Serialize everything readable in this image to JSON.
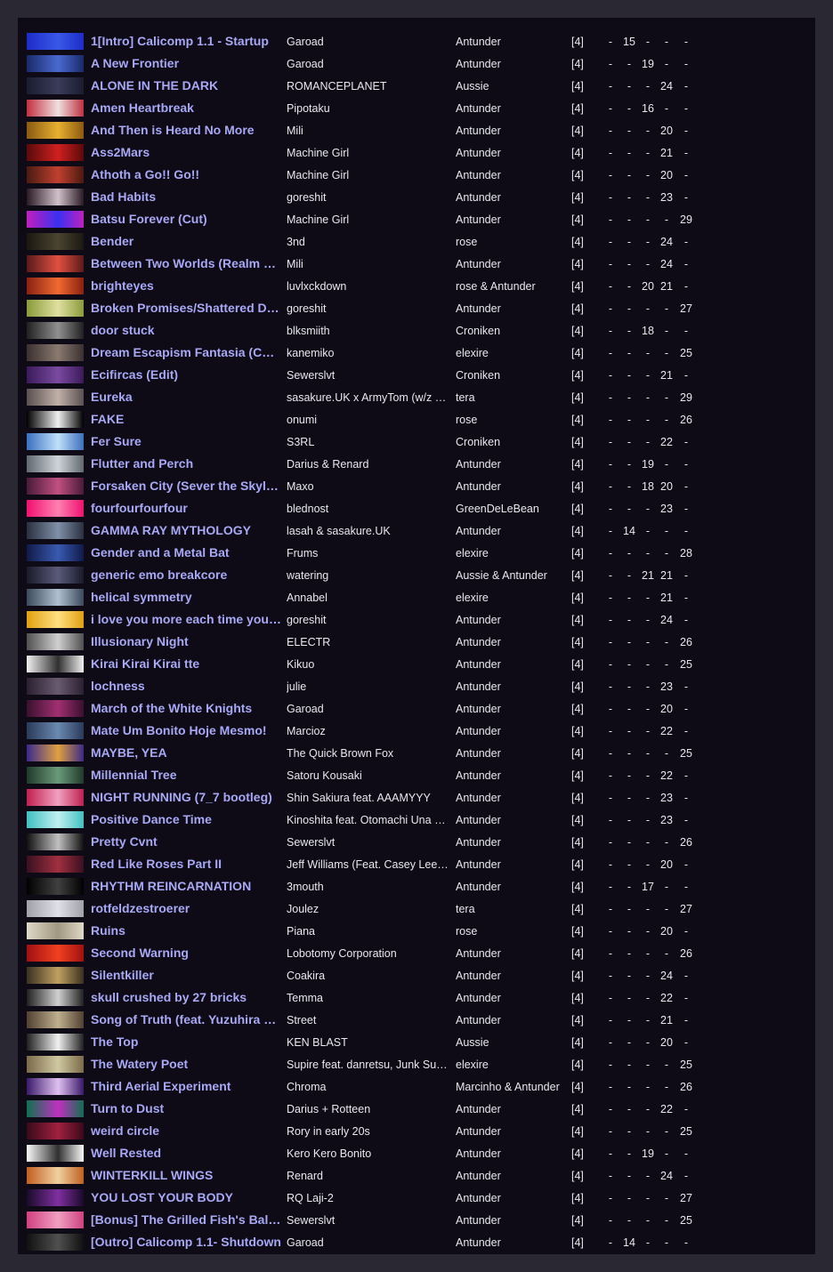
{
  "mode_label": "[4]",
  "rows": [
    {
      "title": "1[Intro] Calicomp 1.1 - Startup",
      "artist": "Garoad",
      "mapper": "Antunder",
      "d": [
        "-",
        "15",
        "-",
        "-",
        "-"
      ],
      "colors": [
        "#1c2cc8",
        "#3a58e8"
      ]
    },
    {
      "title": "A New Frontier",
      "artist": "Garoad",
      "mapper": "Antunder",
      "d": [
        "-",
        "-",
        "19",
        "-",
        "-"
      ],
      "colors": [
        "#1a2a6a",
        "#4a6ad0"
      ]
    },
    {
      "title": "ALONE IN THE DARK",
      "artist": "ROMANCEPLANET",
      "mapper": "Aussie",
      "d": [
        "-",
        "-",
        "-",
        "24",
        "-"
      ],
      "colors": [
        "#1a1c30",
        "#3a3c5a"
      ]
    },
    {
      "title": "Amen Heartbreak",
      "artist": "Pipotaku",
      "mapper": "Antunder",
      "d": [
        "-",
        "-",
        "16",
        "-",
        "-"
      ],
      "colors": [
        "#c03040",
        "#f0e0e0"
      ]
    },
    {
      "title": "And Then is Heard No More",
      "artist": "Mili",
      "mapper": "Antunder",
      "d": [
        "-",
        "-",
        "-",
        "20",
        "-"
      ],
      "colors": [
        "#8a5a10",
        "#e8b030"
      ]
    },
    {
      "title": "Ass2Mars",
      "artist": "Machine Girl",
      "mapper": "Antunder",
      "d": [
        "-",
        "-",
        "-",
        "21",
        "-"
      ],
      "colors": [
        "#5a0a0a",
        "#d02020"
      ]
    },
    {
      "title": "Athoth a Go!! Go!!",
      "artist": "Machine Girl",
      "mapper": "Antunder",
      "d": [
        "-",
        "-",
        "-",
        "20",
        "-"
      ],
      "colors": [
        "#4a1a10",
        "#c04030"
      ]
    },
    {
      "title": "Bad Habits",
      "artist": "goreshit",
      "mapper": "Antunder",
      "d": [
        "-",
        "-",
        "-",
        "23",
        "-"
      ],
      "colors": [
        "#2a1a24",
        "#d0c0c8"
      ]
    },
    {
      "title": "Batsu Forever (Cut)",
      "artist": "Machine Girl",
      "mapper": "Antunder",
      "d": [
        "-",
        "-",
        "-",
        "-",
        "29"
      ],
      "colors": [
        "#c020c0",
        "#3a30f0"
      ]
    },
    {
      "title": "Bender",
      "artist": "3nd",
      "mapper": "rose",
      "d": [
        "-",
        "-",
        "-",
        "24",
        "-"
      ],
      "colors": [
        "#1a1810",
        "#4a4430"
      ]
    },
    {
      "title": "Between Two Worlds (Realm of Light)",
      "artist": "Mili",
      "mapper": "Antunder",
      "d": [
        "-",
        "-",
        "-",
        "24",
        "-"
      ],
      "colors": [
        "#5a1a1a",
        "#e05040"
      ]
    },
    {
      "title": "brighteyes",
      "artist": "luvlxckdown",
      "mapper": "rose & Antunder",
      "d": [
        "-",
        "-",
        "20",
        "21",
        "-"
      ],
      "colors": [
        "#8a2010",
        "#f06a30"
      ]
    },
    {
      "title": "Broken Promises/Shattered Dreams",
      "artist": "goreshit",
      "mapper": "Antunder",
      "d": [
        "-",
        "-",
        "-",
        "-",
        "27"
      ],
      "colors": [
        "#8a9a3a",
        "#e0e0a0"
      ]
    },
    {
      "title": "door stuck",
      "artist": "blksmiith",
      "mapper": "Croniken",
      "d": [
        "-",
        "-",
        "18",
        "-",
        "-"
      ],
      "colors": [
        "#202020",
        "#909090"
      ]
    },
    {
      "title": "Dream Escapism Fantasia (Cut Ver.)",
      "artist": "kanemiko",
      "mapper": "elexire",
      "d": [
        "-",
        "-",
        "-",
        "-",
        "25"
      ],
      "colors": [
        "#3a3030",
        "#8a7a70"
      ]
    },
    {
      "title": "Ecifircas (Edit)",
      "artist": "Sewerslvt",
      "mapper": "Croniken",
      "d": [
        "-",
        "-",
        "-",
        "21",
        "-"
      ],
      "colors": [
        "#3a1a5a",
        "#7a4aa0"
      ]
    },
    {
      "title": "Eureka",
      "artist": "sasakure.UK x ArmyTom (w/z Bunny)",
      "mapper": "tera",
      "d": [
        "-",
        "-",
        "-",
        "-",
        "29"
      ],
      "colors": [
        "#5a5050",
        "#c0b0a8"
      ]
    },
    {
      "title": "FAKE",
      "artist": "onumi",
      "mapper": "rose",
      "d": [
        "-",
        "-",
        "-",
        "-",
        "26"
      ],
      "colors": [
        "#000000",
        "#f0f0f0"
      ]
    },
    {
      "title": "Fer Sure",
      "artist": "S3RL",
      "mapper": "Croniken",
      "d": [
        "-",
        "-",
        "-",
        "22",
        "-"
      ],
      "colors": [
        "#3a70c0",
        "#c0e0f8"
      ]
    },
    {
      "title": "Flutter and Perch",
      "artist": "Darius & Renard",
      "mapper": "Antunder",
      "d": [
        "-",
        "-",
        "19",
        "-",
        "-"
      ],
      "colors": [
        "#606870",
        "#d0d4d8"
      ]
    },
    {
      "title": "Forsaken City (Sever the Skyline Remix)",
      "artist": "Maxo",
      "mapper": "Antunder",
      "d": [
        "-",
        "-",
        "18",
        "20",
        "-"
      ],
      "colors": [
        "#4a1a3a",
        "#c05080"
      ]
    },
    {
      "title": "fourfourfourfour",
      "artist": "blednost",
      "mapper": "GreenDeLeBean",
      "d": [
        "-",
        "-",
        "-",
        "23",
        "-"
      ],
      "colors": [
        "#f01070",
        "#ff80b0"
      ]
    },
    {
      "title": "GAMMA RAY MYTHOLOGY",
      "artist": "lasah & sasakure.UK",
      "mapper": "Antunder",
      "d": [
        "-",
        "14",
        "-",
        "-",
        "-"
      ],
      "colors": [
        "#2a3040",
        "#8090a8"
      ]
    },
    {
      "title": "Gender and a Metal Bat",
      "artist": "Frums",
      "mapper": "elexire",
      "d": [
        "-",
        "-",
        "-",
        "-",
        "28"
      ],
      "colors": [
        "#101a4a",
        "#3a5ab0"
      ]
    },
    {
      "title": "generic emo breakcore",
      "artist": "watering",
      "mapper": "Aussie & Antunder",
      "d": [
        "-",
        "-",
        "21",
        "21",
        "-"
      ],
      "colors": [
        "#1a1a2a",
        "#5a5a7a"
      ]
    },
    {
      "title": "helical symmetry",
      "artist": "Annabel",
      "mapper": "elexire",
      "d": [
        "-",
        "-",
        "-",
        "21",
        "-"
      ],
      "colors": [
        "#3a4a5a",
        "#b0c0d0"
      ]
    },
    {
      "title": "i love you more each time you die",
      "artist": "goreshit",
      "mapper": "Antunder",
      "d": [
        "-",
        "-",
        "-",
        "24",
        "-"
      ],
      "colors": [
        "#e0a010",
        "#ffe080"
      ]
    },
    {
      "title": "Illusionary Night",
      "artist": "ELECTR",
      "mapper": "Antunder",
      "d": [
        "-",
        "-",
        "-",
        "-",
        "26"
      ],
      "colors": [
        "#505050",
        "#d0d0d0"
      ]
    },
    {
      "title": "Kirai Kirai Kirai tte",
      "artist": "Kikuo",
      "mapper": "Antunder",
      "d": [
        "-",
        "-",
        "-",
        "-",
        "25"
      ],
      "colors": [
        "#f0f0f0",
        "#303030"
      ]
    },
    {
      "title": "lochness",
      "artist": "julie",
      "mapper": "Antunder",
      "d": [
        "-",
        "-",
        "-",
        "23",
        "-"
      ],
      "colors": [
        "#2a2030",
        "#6a5a70"
      ]
    },
    {
      "title": "March of the White Knights",
      "artist": "Garoad",
      "mapper": "Antunder",
      "d": [
        "-",
        "-",
        "-",
        "20",
        "-"
      ],
      "colors": [
        "#3a1030",
        "#a03070"
      ]
    },
    {
      "title": "Mate Um Bonito Hoje Mesmo!",
      "artist": "Marcioz",
      "mapper": "Antunder",
      "d": [
        "-",
        "-",
        "-",
        "22",
        "-"
      ],
      "colors": [
        "#2a3a5a",
        "#6a8ab0"
      ]
    },
    {
      "title": "MAYBE, YEA",
      "artist": "The Quick Brown Fox",
      "mapper": "Antunder",
      "d": [
        "-",
        "-",
        "-",
        "-",
        "25"
      ],
      "colors": [
        "#3a2a8a",
        "#e0a040"
      ]
    },
    {
      "title": "Millennial Tree",
      "artist": "Satoru Kousaki",
      "mapper": "Antunder",
      "d": [
        "-",
        "-",
        "-",
        "22",
        "-"
      ],
      "colors": [
        "#203a2a",
        "#6a9a7a"
      ]
    },
    {
      "title": "NIGHT RUNNING (7_7 bootleg)",
      "artist": "Shin Sakiura feat. AAAMYYY",
      "mapper": "Antunder",
      "d": [
        "-",
        "-",
        "-",
        "23",
        "-"
      ],
      "colors": [
        "#c02050",
        "#f0a0c0"
      ]
    },
    {
      "title": "Positive Dance Time",
      "artist": "Kinoshita feat. Otomachi Una & Kagamine Rin",
      "mapper": "Antunder",
      "d": [
        "-",
        "-",
        "-",
        "23",
        "-"
      ],
      "colors": [
        "#40c0c0",
        "#c0f0f0"
      ]
    },
    {
      "title": "Pretty Cvnt",
      "artist": "Sewerslvt",
      "mapper": "Antunder",
      "d": [
        "-",
        "-",
        "-",
        "-",
        "26"
      ],
      "colors": [
        "#101010",
        "#c0c0c0"
      ]
    },
    {
      "title": "Red Like Roses Part II",
      "artist": "Jeff Williams (Feat. Casey Lee Williams)",
      "mapper": "Antunder",
      "d": [
        "-",
        "-",
        "-",
        "20",
        "-"
      ],
      "colors": [
        "#3a1020",
        "#a03040"
      ]
    },
    {
      "title": "RHYTHM REINCARNATION",
      "artist": "3mouth",
      "mapper": "Antunder",
      "d": [
        "-",
        "-",
        "17",
        "-",
        "-"
      ],
      "colors": [
        "#000000",
        "#404040"
      ]
    },
    {
      "title": "rotfeldzestroerer",
      "artist": "Joulez",
      "mapper": "tera",
      "d": [
        "-",
        "-",
        "-",
        "-",
        "27"
      ],
      "colors": [
        "#a0a0a8",
        "#e0e0e8"
      ]
    },
    {
      "title": "Ruins",
      "artist": "Piana",
      "mapper": "rose",
      "d": [
        "-",
        "-",
        "-",
        "20",
        "-"
      ],
      "colors": [
        "#e0d8c8",
        "#a09880"
      ]
    },
    {
      "title": "Second Warning",
      "artist": "Lobotomy Corporation",
      "mapper": "Antunder",
      "d": [
        "-",
        "-",
        "-",
        "-",
        "26"
      ],
      "colors": [
        "#a01010",
        "#f04020"
      ]
    },
    {
      "title": "Silentkiller",
      "artist": "Coakira",
      "mapper": "Antunder",
      "d": [
        "-",
        "-",
        "-",
        "24",
        "-"
      ],
      "colors": [
        "#3a3020",
        "#c0a060"
      ]
    },
    {
      "title": "skull crushed by 27 bricks",
      "artist": "Temma",
      "mapper": "Antunder",
      "d": [
        "-",
        "-",
        "-",
        "22",
        "-"
      ],
      "colors": [
        "#202020",
        "#d0d0d0"
      ]
    },
    {
      "title": "Song of Truth (feat. Yuzuhira Eri)",
      "artist": "Street",
      "mapper": "Antunder",
      "d": [
        "-",
        "-",
        "-",
        "21",
        "-"
      ],
      "colors": [
        "#504030",
        "#c0b090"
      ]
    },
    {
      "title": "The Top",
      "artist": "KEN BLAST",
      "mapper": "Aussie",
      "d": [
        "-",
        "-",
        "-",
        "20",
        "-"
      ],
      "colors": [
        "#202020",
        "#f0f0f0"
      ]
    },
    {
      "title": "The Watery Poet",
      "artist": "Supire feat. danretsu, Junk Sugar",
      "mapper": "elexire",
      "d": [
        "-",
        "-",
        "-",
        "-",
        "25"
      ],
      "colors": [
        "#7a6a4a",
        "#d0c8a0"
      ]
    },
    {
      "title": "Third Aerial Experiment",
      "artist": "Chroma",
      "mapper": "Marcinho & Antunder",
      "d": [
        "-",
        "-",
        "-",
        "-",
        "26"
      ],
      "colors": [
        "#3a1a6a",
        "#e0c0f0"
      ]
    },
    {
      "title": "Turn to Dust",
      "artist": "Darius + Rotteen",
      "mapper": "Antunder",
      "d": [
        "-",
        "-",
        "-",
        "22",
        "-"
      ],
      "colors": [
        "#107050",
        "#c030c0"
      ]
    },
    {
      "title": "weird circle",
      "artist": "Rory in early 20s",
      "mapper": "Antunder",
      "d": [
        "-",
        "-",
        "-",
        "-",
        "25"
      ],
      "colors": [
        "#3a0a1a",
        "#a02040"
      ]
    },
    {
      "title": "Well Rested",
      "artist": "Kero Kero Bonito",
      "mapper": "Antunder",
      "d": [
        "-",
        "-",
        "19",
        "-",
        "-"
      ],
      "colors": [
        "#f8f8f8",
        "#303030"
      ]
    },
    {
      "title": "WINTERKILL WINGS",
      "artist": "Renard",
      "mapper": "Antunder",
      "d": [
        "-",
        "-",
        "-",
        "24",
        "-"
      ],
      "colors": [
        "#c06020",
        "#f0d0a0"
      ]
    },
    {
      "title": "YOU LOST YOUR BODY",
      "artist": "RQ Laji-2",
      "mapper": "Antunder",
      "d": [
        "-",
        "-",
        "-",
        "-",
        "27"
      ],
      "colors": [
        "#1a0a2a",
        "#8030a0"
      ]
    },
    {
      "title": "[Bonus] The Grilled Fish's Ballad",
      "artist": "Sewerslvt",
      "mapper": "Antunder",
      "d": [
        "-",
        "-",
        "-",
        "-",
        "25"
      ],
      "colors": [
        "#d04080",
        "#f0a0c0"
      ]
    },
    {
      "title": "[Outro] Calicomp 1.1- Shutdown",
      "artist": "Garoad",
      "mapper": "Antunder",
      "d": [
        "-",
        "14",
        "-",
        "-",
        "-"
      ],
      "colors": [
        "#101010",
        "#505050"
      ]
    }
  ]
}
